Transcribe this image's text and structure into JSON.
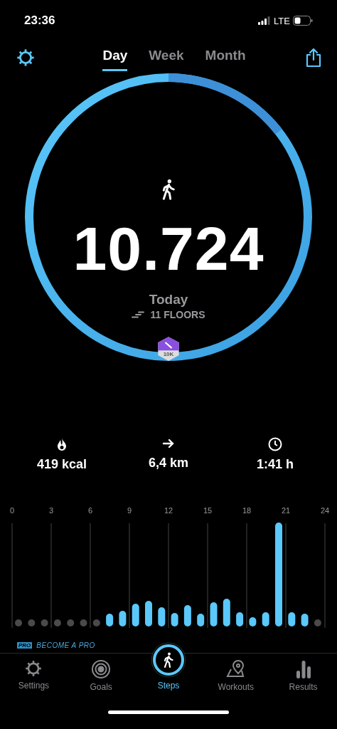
{
  "status_bar": {
    "time": "23:36",
    "network": "LTE"
  },
  "period_tabs": [
    {
      "label": "Day",
      "selected": true
    },
    {
      "label": "Week",
      "selected": false
    },
    {
      "label": "Month",
      "selected": false
    }
  ],
  "summary": {
    "steps": "10.724",
    "period": "Today",
    "floors": "11 FLOORS",
    "badge": "10K"
  },
  "stats": [
    {
      "kind": "calories",
      "value": "419 kcal"
    },
    {
      "kind": "distance",
      "value": "6,4 km"
    },
    {
      "kind": "duration",
      "value": "1:41 h"
    }
  ],
  "hour_labels": [
    "0",
    "3",
    "6",
    "9",
    "12",
    "15",
    "18",
    "21",
    "24"
  ],
  "promo": {
    "tag": "PRO",
    "text": "BECOME A PRO"
  },
  "tab_bar": [
    {
      "kind": "settings",
      "label": "Settings",
      "selected": false
    },
    {
      "kind": "goals",
      "label": "Goals",
      "selected": false
    },
    {
      "kind": "steps",
      "label": "Steps",
      "selected": true
    },
    {
      "kind": "workouts",
      "label": "Workouts",
      "selected": false
    },
    {
      "kind": "results",
      "label": "Results",
      "selected": false
    }
  ]
}
